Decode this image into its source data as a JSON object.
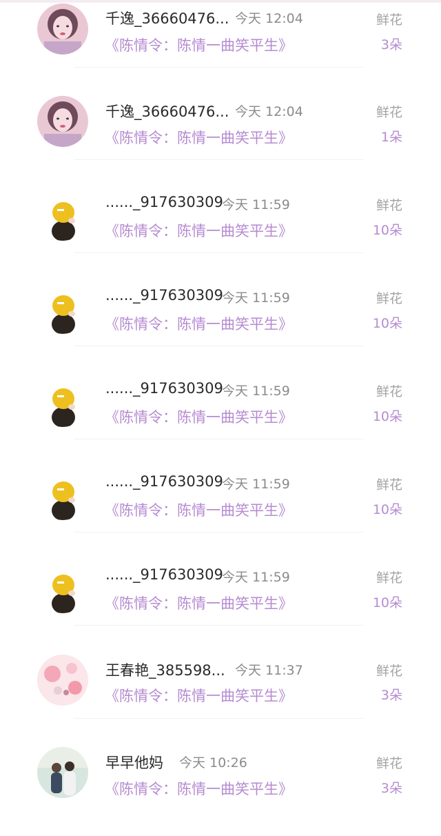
{
  "items": [
    {
      "username": "千逸_36660476...",
      "time": "今天 12:04",
      "book": "《陈情令：陈情一曲笑平生》",
      "gift_type": "鲜花",
      "gift_count": "3朵",
      "avatar": "woman-portrait"
    },
    {
      "username": "千逸_36660476...",
      "time": "今天 12:04",
      "book": "《陈情令：陈情一曲笑平生》",
      "gift_type": "鲜花",
      "gift_count": "1朵",
      "avatar": "woman-portrait"
    },
    {
      "username": "......_917630309",
      "time": "今天 11:59",
      "book": "《陈情令：陈情一曲笑平生》",
      "gift_type": "鲜花",
      "gift_count": "10朵",
      "avatar": "yellow-hat-girl"
    },
    {
      "username": "......_917630309",
      "time": "今天 11:59",
      "book": "《陈情令：陈情一曲笑平生》",
      "gift_type": "鲜花",
      "gift_count": "10朵",
      "avatar": "yellow-hat-girl"
    },
    {
      "username": "......_917630309",
      "time": "今天 11:59",
      "book": "《陈情令：陈情一曲笑平生》",
      "gift_type": "鲜花",
      "gift_count": "10朵",
      "avatar": "yellow-hat-girl"
    },
    {
      "username": "......_917630309",
      "time": "今天 11:59",
      "book": "《陈情令：陈情一曲笑平生》",
      "gift_type": "鲜花",
      "gift_count": "10朵",
      "avatar": "yellow-hat-girl"
    },
    {
      "username": "......_917630309",
      "time": "今天 11:59",
      "book": "《陈情令：陈情一曲笑平生》",
      "gift_type": "鲜花",
      "gift_count": "10朵",
      "avatar": "yellow-hat-girl"
    },
    {
      "username": "王春艳_385598...",
      "time": "今天 11:37",
      "book": "《陈情令：陈情一曲笑平生》",
      "gift_type": "鲜花",
      "gift_count": "3朵",
      "avatar": "pink-floral"
    },
    {
      "username": "早早他妈",
      "time": "今天 10:26",
      "book": "《陈情令：陈情一曲笑平生》",
      "gift_type": "鲜花",
      "gift_count": "3朵",
      "avatar": "couple-photo"
    }
  ],
  "colors": {
    "accent": "#b68bd1",
    "name": "#2a2a2a",
    "time": "#8b8b8b",
    "type": "#a3a3a3"
  }
}
